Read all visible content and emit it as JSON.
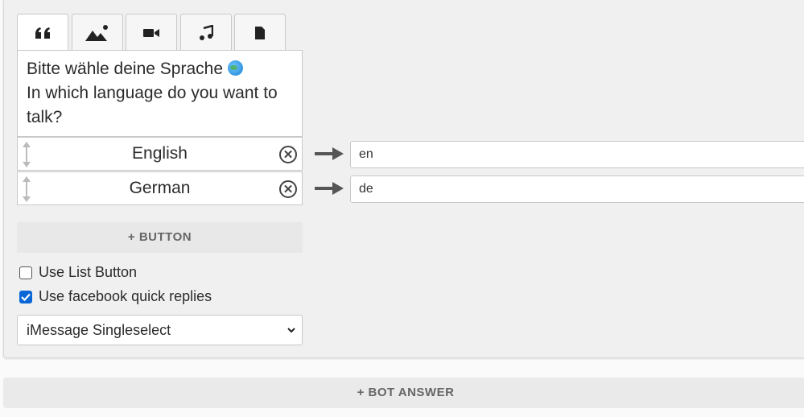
{
  "tabs": [
    {
      "icon": "quote-icon",
      "active": true
    },
    {
      "icon": "image-icon",
      "active": false
    },
    {
      "icon": "video-icon",
      "active": false
    },
    {
      "icon": "music-icon",
      "active": false
    },
    {
      "icon": "file-icon",
      "active": false
    }
  ],
  "message": {
    "line1": "Bitte wähle deine Sprache",
    "emoji": "globe-icon",
    "line2": "In which language do you want to talk?"
  },
  "buttons": [
    {
      "label": "English",
      "payload": "en"
    },
    {
      "label": "German",
      "payload": "de"
    }
  ],
  "add_button_label": "+ BUTTON",
  "options": {
    "list_button": {
      "label": "Use List Button",
      "checked": false
    },
    "quick_replies": {
      "label": "Use facebook quick replies",
      "checked": true
    }
  },
  "select": {
    "value": "iMessage Singleselect"
  },
  "bot_answer_label": "+ BOT ANSWER",
  "colors": {
    "accent": "#0a66d6",
    "card": "#f0f0f0",
    "border": "#c8c8c8"
  }
}
